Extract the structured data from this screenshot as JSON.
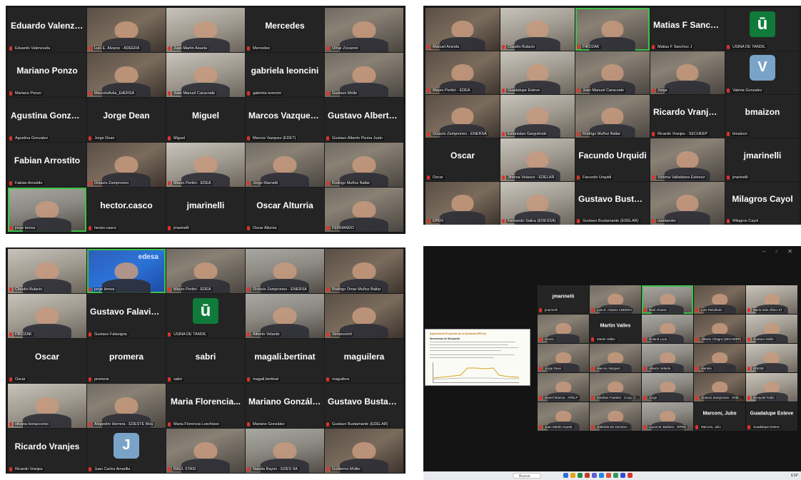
{
  "panels": [
    {
      "id": "panel-1",
      "tiles": [
        {
          "label": "Eduardo Valenzuela",
          "big": "Eduardo Valenzu..."
        },
        {
          "label": "Luis E. Alvarez - ADEERA"
        },
        {
          "label": "Juan Martin Asueta"
        },
        {
          "label": "Mercedes",
          "big": "Mercedes"
        },
        {
          "label": "Omar Zocaroni"
        },
        {
          "label": "Mariano Ponzo",
          "big": "Mariano Ponzo"
        },
        {
          "label": "MarceloAvila_EdERSA"
        },
        {
          "label": "Juan Manuel Caracoale"
        },
        {
          "label": "gabriela leoncini",
          "big": "gabriela leoncini"
        },
        {
          "label": "Gustavo Molle"
        },
        {
          "label": "Agustina Gonzalez",
          "big": "Agustina Gonzalez"
        },
        {
          "label": "Jorge Dean",
          "big": "Jorge Dean"
        },
        {
          "label": "Miguel",
          "big": "Miguel"
        },
        {
          "label": "Marcos Vazquez (EDET)",
          "big": "Marcos Vazquez..."
        },
        {
          "label": "Gustavo Alberto Piuma Justo",
          "big": "Gustavo Alberto..."
        },
        {
          "label": "Fabian Arrostito",
          "big": "Fabian Arrostito"
        },
        {
          "label": "Octavio Zamproneo"
        },
        {
          "label": "Mauro Pertini - EDEA"
        },
        {
          "label": "Jorge Marnetti"
        },
        {
          "label": "Rodrigo Muñoz Baltar"
        },
        {
          "label": "jorge lemos"
        },
        {
          "label": "hector.casco",
          "big": "hector.casco"
        },
        {
          "label": "jmarinelli",
          "big": "jmarinelli"
        },
        {
          "label": "Oscar Alturria",
          "big": "Oscar Alturria"
        },
        {
          "label": "FERNANDO"
        }
      ]
    },
    {
      "id": "panel-2",
      "tiles": [
        {
          "label": "Manuel Aranda"
        },
        {
          "label": "Claudio Bulacio"
        },
        {
          "label": "FIKOZAK"
        },
        {
          "label": "Matias F Sanchez J",
          "big": "Matias F Sanchez J"
        },
        {
          "label": "USINA DE TANDIL",
          "avatar": "ū"
        },
        {
          "label": "Mauro Pertini - EDEA"
        },
        {
          "label": "Guadalupe Esteve"
        },
        {
          "label": "Juan Manuel Caracoale"
        },
        {
          "label": "Jorge"
        },
        {
          "label": "Valeria Gonzalez",
          "avatar": "V"
        },
        {
          "label": "Octavio Zamproneo - ENERSA"
        },
        {
          "label": "Estanislao Gargulinski"
        },
        {
          "label": "Rodrigo Muñoz Baltar"
        },
        {
          "label": "Ricardo Vranjes - SECHEEP",
          "big": "Ricardo Vranjes..."
        },
        {
          "label": "bmaizon",
          "big": "bmaizon"
        },
        {
          "label": "Oscar",
          "big": "Oscar"
        },
        {
          "label": "Jimena Velasco - EDELAR"
        },
        {
          "label": "Facundo Urquidi",
          "big": "Facundo Urquidi"
        },
        {
          "label": "Victoria Valladares Estevez"
        },
        {
          "label": "jmarinelli",
          "big": "jmarinelli"
        },
        {
          "label": "EPEN"
        },
        {
          "label": "Fernando Salica (EDESSA)"
        },
        {
          "label": "Gustavo Bustamante (EDELAR)",
          "big": "Gustavo Bustam..."
        },
        {
          "label": "rsantander"
        },
        {
          "label": "Milagros Cayol",
          "big": "Milagros Cayol"
        }
      ]
    },
    {
      "id": "panel-3",
      "tiles": [
        {
          "label": "Claudio Bulacio"
        },
        {
          "label": "jorge lemos",
          "logo_text": "edesa"
        },
        {
          "label": "Mauro Pertini - EDEA"
        },
        {
          "label": "Octavio Zamproneo - ENERSA"
        },
        {
          "label": "Rodrigo Omar Muñoz Baltar"
        },
        {
          "label": "FIKOZAK"
        },
        {
          "label": "Gustavo Falavigna",
          "big": "Gustavo Falavigna"
        },
        {
          "label": "USINA DE TANDIL",
          "avatar": "ū"
        },
        {
          "label": "Alberto Velarde"
        },
        {
          "label": "Simanovich"
        },
        {
          "label": "Oscar",
          "big": "Oscar"
        },
        {
          "label": "promera",
          "big": "promera"
        },
        {
          "label": "sabri",
          "big": "sabri"
        },
        {
          "label": "magali.bertinat",
          "big": "magali.bertinat"
        },
        {
          "label": "maguilera",
          "big": "maguilera"
        },
        {
          "label": "silvana bonaccorso"
        },
        {
          "label": "Alejandro Herrera - EDESTE Mza"
        },
        {
          "label": "Maria Florencia Loschiavo",
          "big": "Maria Florencia..."
        },
        {
          "label": "Mariano González",
          "big": "Mariano González"
        },
        {
          "label": "Gustavo Bustamante (EDELAR)",
          "big": "Gustavo Bustam..."
        },
        {
          "label": "Ricardo Vranjes",
          "big": "Ricardo Vranjes"
        },
        {
          "label": "Juan Carlos Amarilla",
          "avatar": "J"
        },
        {
          "label": "RAUL STASI"
        },
        {
          "label": "Natalia Bayon - EDES SA"
        },
        {
          "label": "Guillermo Müller"
        }
      ]
    },
    {
      "id": "panel-4",
      "window_controls": "– ▫ ✕",
      "document": {
        "title": "Seguimiento Proyectos de la Demanda (PPD-D)",
        "subtitle": "Mecanismo de Búsqueda"
      },
      "tiles": [
        {
          "label": "jmarinelli",
          "big": "jmarinelli"
        },
        {
          "label": "Luis E. Alvarez ADEERA"
        },
        {
          "label": "Raúl Alvarez"
        },
        {
          "label": "Luis Rebolledo"
        },
        {
          "label": "María Inés Alfaro ST"
        },
        {
          "label": "Cervio"
        },
        {
          "label": "Martin Valles",
          "big": "Martin Valles"
        },
        {
          "label": "Roland Luca"
        },
        {
          "label": "Alberto Chagra (SECHEEP)"
        },
        {
          "label": "Gustavo Molle"
        },
        {
          "label": "Jorge Dean"
        },
        {
          "label": "Marcos Vazquez"
        },
        {
          "label": "Alberto Velarde"
        },
        {
          "label": "Mariela"
        },
        {
          "label": "EDESE"
        },
        {
          "label": "Daniel Branca - APELP"
        },
        {
          "label": "Esteban Fuentes - Coop. CALF"
        },
        {
          "label": "Jorge"
        },
        {
          "label": "Octavio Zamproneo - ENERSA"
        },
        {
          "label": "Ezequiel Fedio"
        },
        {
          "label": "Juan Martin Asueta"
        },
        {
          "label": "Gabriela De Gennaro"
        },
        {
          "label": "Lucas M. Barbero - EPEN"
        },
        {
          "label": "Marconi, Julio",
          "big": "Marconi, Julio"
        },
        {
          "label": "Guadalupe Esteve",
          "big": "Guadalupe Esteve"
        }
      ],
      "taskbar": {
        "search": "Buscar",
        "clock": "ESP"
      }
    }
  ]
}
